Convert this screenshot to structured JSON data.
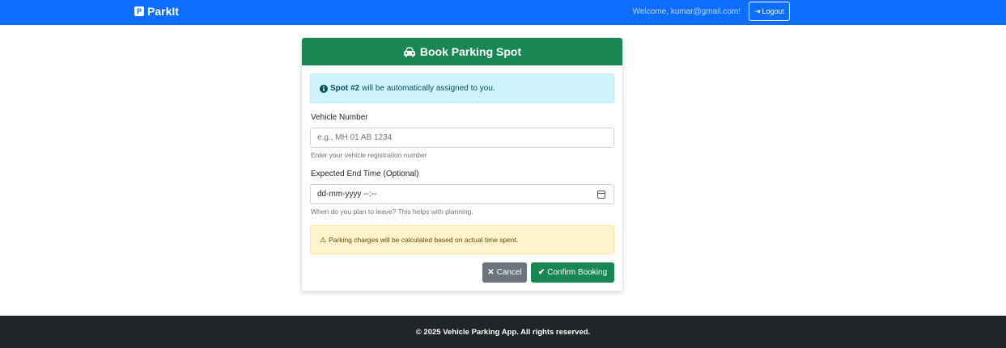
{
  "navbar": {
    "brand_badge": "P",
    "brand": "ParkIt",
    "welcome": "Welcome, kumar@gmail.com!",
    "logout_label": "Logout",
    "bg_color": "#0d6efd"
  },
  "card": {
    "title": "Book Parking Spot",
    "header_color": "#198754",
    "info_alert": {
      "icon": "i",
      "strong": "Spot #2",
      "text": "will be automatically assigned to you."
    },
    "vehicle": {
      "label": "Vehicle Number",
      "placeholder": "e.g., MH 01 AB 1234",
      "help": "Enter your vehicle registration number"
    },
    "end_time": {
      "label": "Expected End Time (Optional)",
      "value": "dd-mm-yyyy --:--",
      "help": "When do you plan to leave? This helps with planning."
    },
    "warning_alert": {
      "icon": "⚠",
      "text": "Parking charges will be calculated based on actual time spent."
    },
    "cancel": {
      "icon": "✕",
      "label": "Cancel"
    },
    "confirm": {
      "icon": "✔",
      "label": "Confirm Booking"
    }
  },
  "footer": {
    "text": "© 2025 Vehicle Parking App. All rights reserved."
  }
}
